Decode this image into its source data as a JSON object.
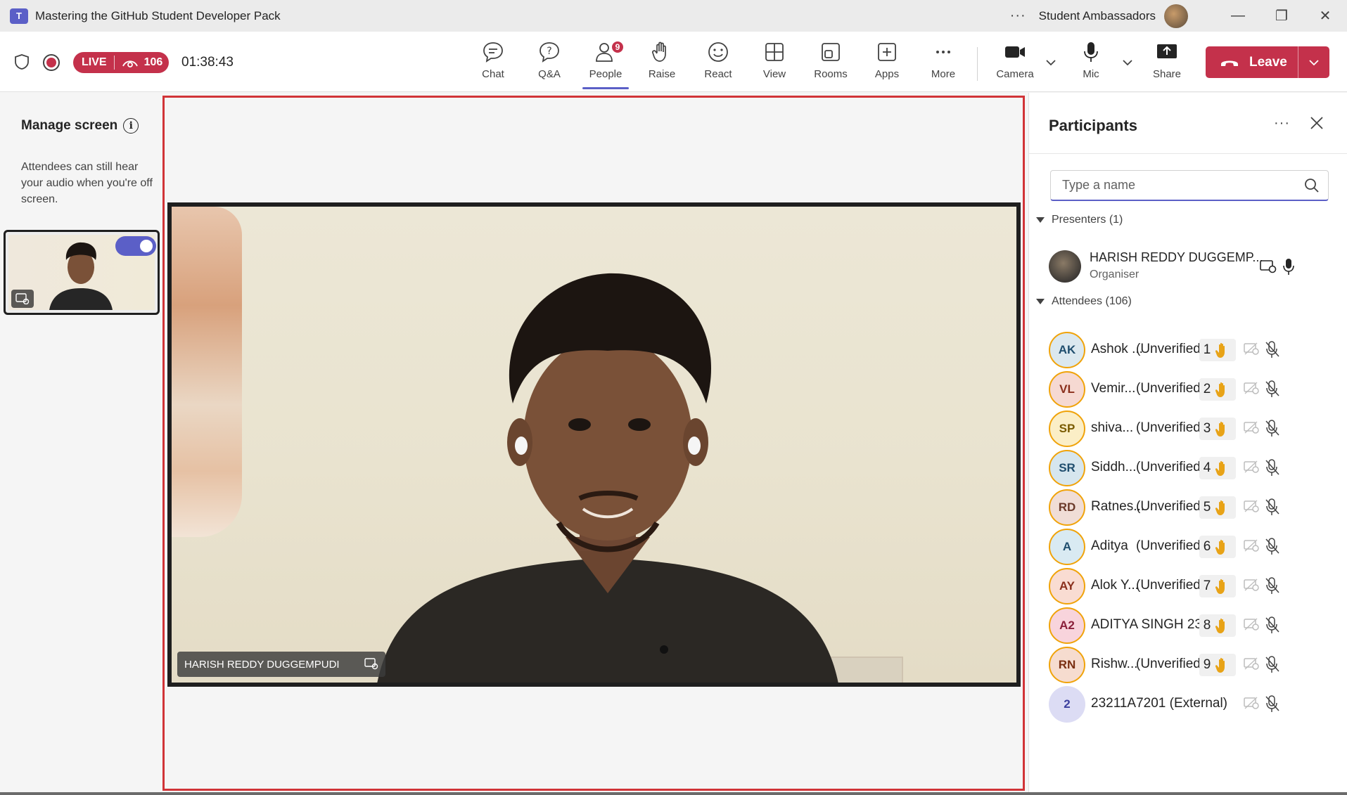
{
  "window": {
    "title": "Mastering the GitHub Student Developer Pack",
    "app_logo": "T",
    "more": "···",
    "org_name": "Student Ambassadors",
    "minimize": "—",
    "restore": "❐",
    "close": "✕"
  },
  "meeting": {
    "live_label": "LIVE",
    "viewer_count": "106",
    "elapsed": "01:38:43"
  },
  "toolbar": {
    "chat": "Chat",
    "qa": "Q&A",
    "people": "People",
    "people_badge": "9",
    "raise": "Raise",
    "react": "React",
    "view": "View",
    "rooms": "Rooms",
    "apps": "Apps",
    "more": "More",
    "camera": "Camera",
    "mic": "Mic",
    "share": "Share",
    "leave": "Leave"
  },
  "manage_screen": {
    "title": "Manage screen",
    "info": "i",
    "description": "Attendees can still hear your audio when you're off screen."
  },
  "stage": {
    "speaker_name": "HARISH REDDY DUGGEMPUDI"
  },
  "participants": {
    "title": "Participants",
    "more": "···",
    "search_placeholder": "Type a name",
    "presenters_header": "Presenters (1)",
    "presenter": {
      "name": "HARISH REDDY DUGGEMP...",
      "role": "Organiser"
    },
    "attendees_header": "Attendees (106)",
    "attendees": [
      {
        "initials": "AK",
        "name": "Ashok ...",
        "status": "(Unverified)",
        "hand": "1",
        "bg": "#dbe8ef",
        "fg": "#1f4e6e"
      },
      {
        "initials": "VL",
        "name": "Vemir...",
        "status": "(Unverified)",
        "hand": "2",
        "bg": "#f6d9d2",
        "fg": "#8a2f1c"
      },
      {
        "initials": "SP",
        "name": "shiva...",
        "status": "(Unverified)",
        "hand": "3",
        "bg": "#fbeec6",
        "fg": "#7a5b00"
      },
      {
        "initials": "SR",
        "name": "Siddh...",
        "status": "(Unverified)",
        "hand": "4",
        "bg": "#d6e6ee",
        "fg": "#1f4e6e"
      },
      {
        "initials": "RD",
        "name": "Ratnes...",
        "status": "(Unverified)",
        "hand": "5",
        "bg": "#f0ddd6",
        "fg": "#6b3a2a"
      },
      {
        "initials": "A",
        "name": "Aditya",
        "status": "(Unverified)",
        "hand": "6",
        "bg": "#d9eaf2",
        "fg": "#1f4e6e"
      },
      {
        "initials": "AY",
        "name": "Alok Y...",
        "status": "(Unverified)",
        "hand": "7",
        "bg": "#f9dcd2",
        "fg": "#8a2f1c"
      },
      {
        "initials": "A2",
        "name": "ADITYA SINGH 23...",
        "status": "",
        "hand": "8",
        "bg": "#f8d4dc",
        "fg": "#8a1f3a"
      },
      {
        "initials": "RN",
        "name": "Rishw...",
        "status": "(Unverified)",
        "hand": "9",
        "bg": "#f6dccf",
        "fg": "#7a2f12"
      },
      {
        "initials": "2",
        "name": "23211A7201 (External)",
        "status": "",
        "hand": "",
        "bg": "#dcdcf4",
        "fg": "#3b3f9e"
      }
    ]
  },
  "colors": {
    "accent": "#5b5fc7",
    "leave_red": "#c4314b",
    "stage_border": "#d13438",
    "hand_yellow": "#e8a317"
  }
}
